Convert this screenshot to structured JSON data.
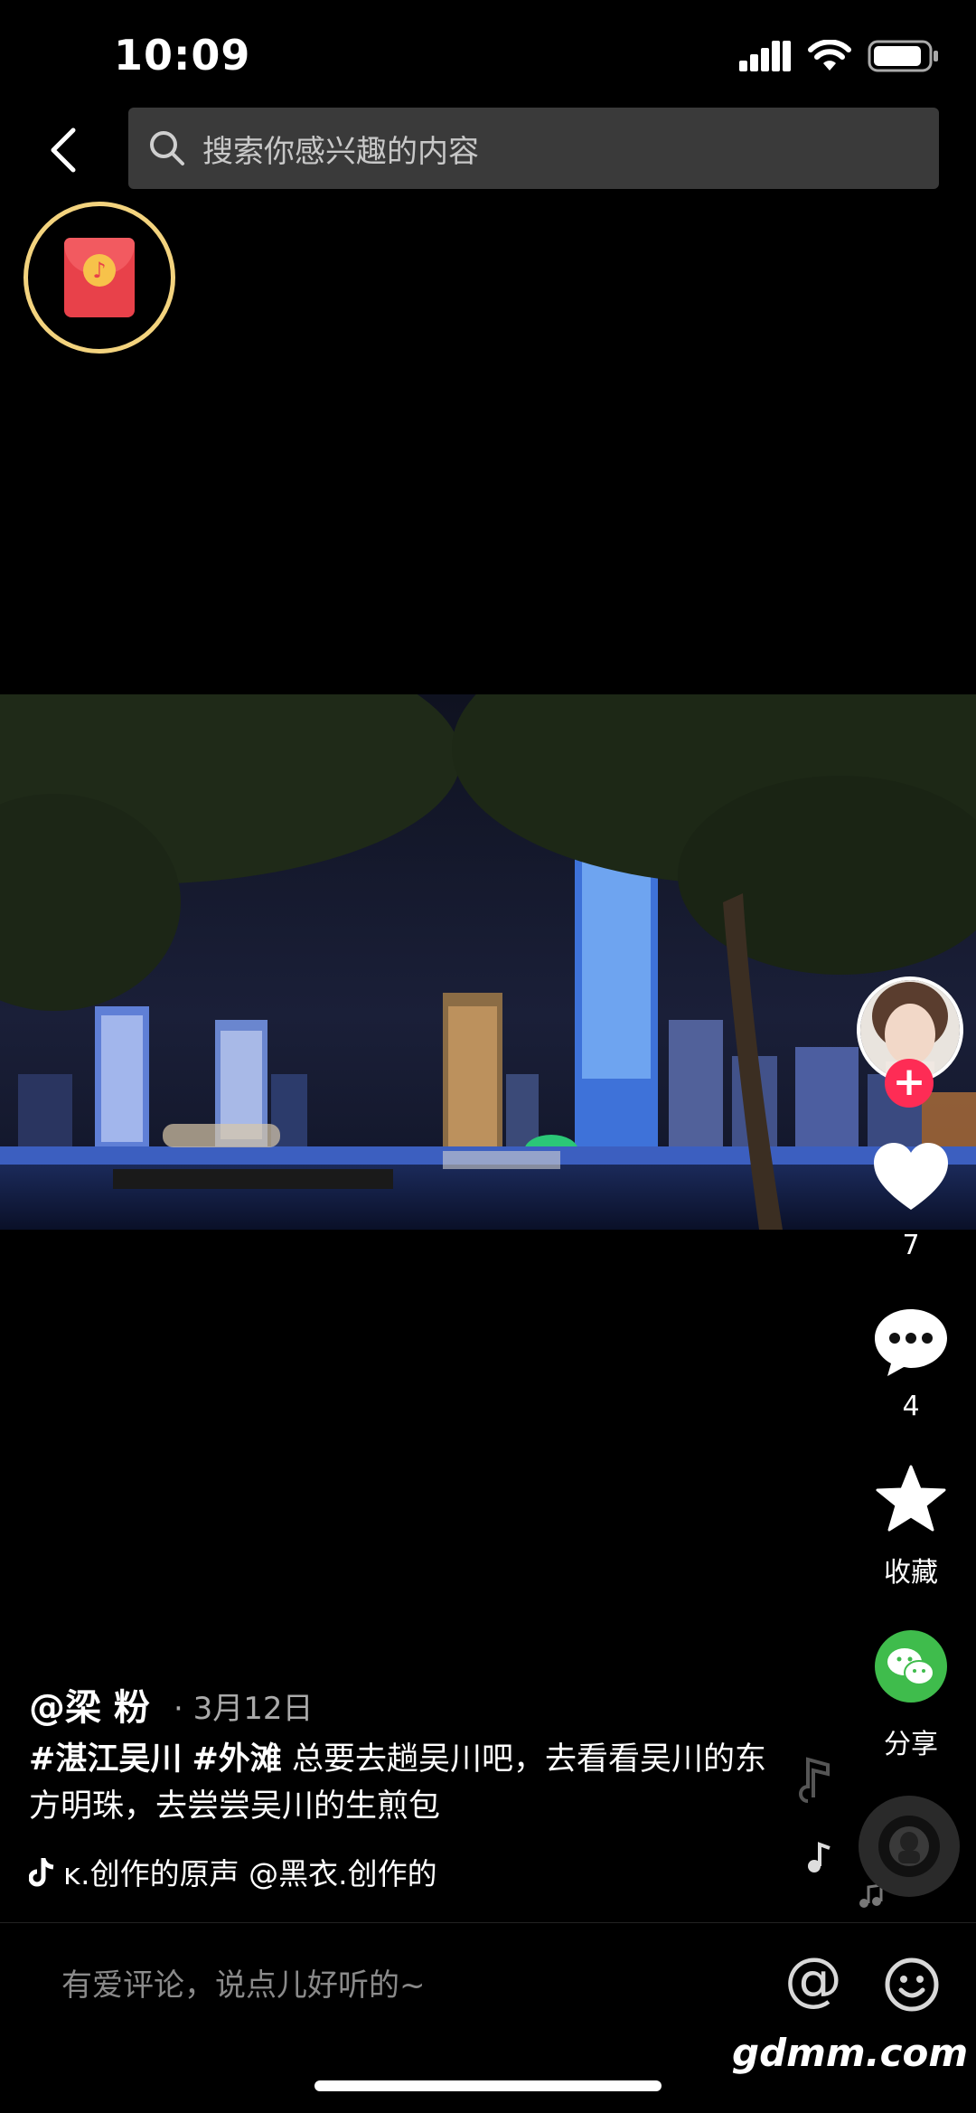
{
  "status_bar": {
    "time": "10:09"
  },
  "search": {
    "placeholder": "搜索你感兴趣的内容"
  },
  "rail": {
    "likes": "7",
    "comments": "4",
    "favorite_label": "收藏",
    "share_label": "分享"
  },
  "post": {
    "author": "@梁 粉",
    "date": "· 3月12日",
    "hashtag1": "#湛江吴川",
    "hashtag2": "#外滩",
    "description": "总要去趟吴川吧，去看看吴川的东方明珠，去尝尝吴川的生煎包",
    "music": "ᴋ.创作的原声    @黑衣.创作的"
  },
  "comment_bar": {
    "placeholder": "有爱评论，说点儿好听的~",
    "at_symbol": "@"
  },
  "watermark": "gdmm.com",
  "colors": {
    "accent_red": "#fe2c55",
    "wechat_green": "#3fbc4c",
    "ring_gold": "#f3d37e"
  }
}
